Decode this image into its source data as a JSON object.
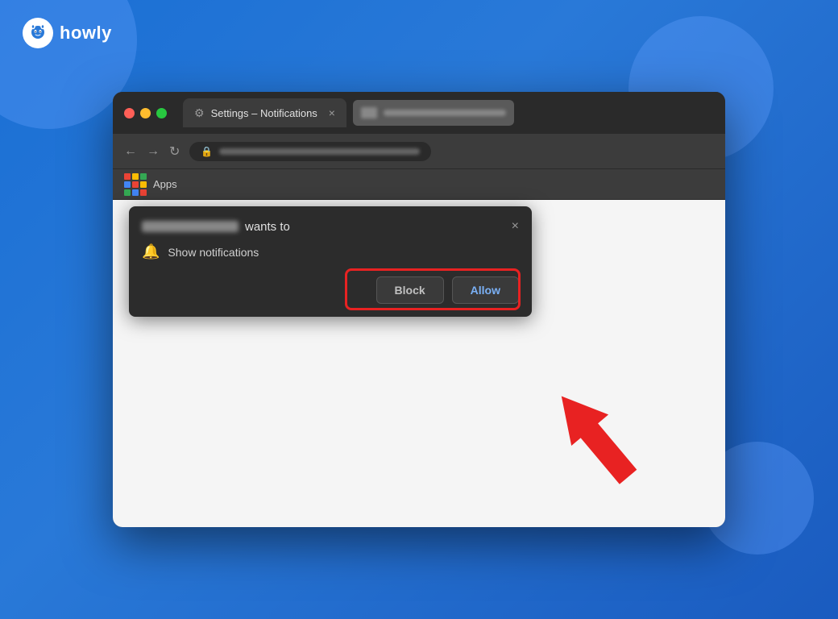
{
  "brand": {
    "name": "howly",
    "logo_emoji": "🐱"
  },
  "browser": {
    "tab_title": "Settings – Notifications",
    "tab_close": "×",
    "nav_back": "←",
    "nav_forward": "→",
    "nav_refresh": "↻",
    "apps_label": "Apps"
  },
  "popup": {
    "site_wants_to": "wants to",
    "notification_text": "Show notifications",
    "block_label": "Block",
    "allow_label": "Allow",
    "close_label": "×"
  },
  "colors": {
    "bg_blue": "#2979d8",
    "red_highlight": "#e82222",
    "allow_text": "#7ab0f5",
    "popup_bg": "#2c2c2c"
  }
}
